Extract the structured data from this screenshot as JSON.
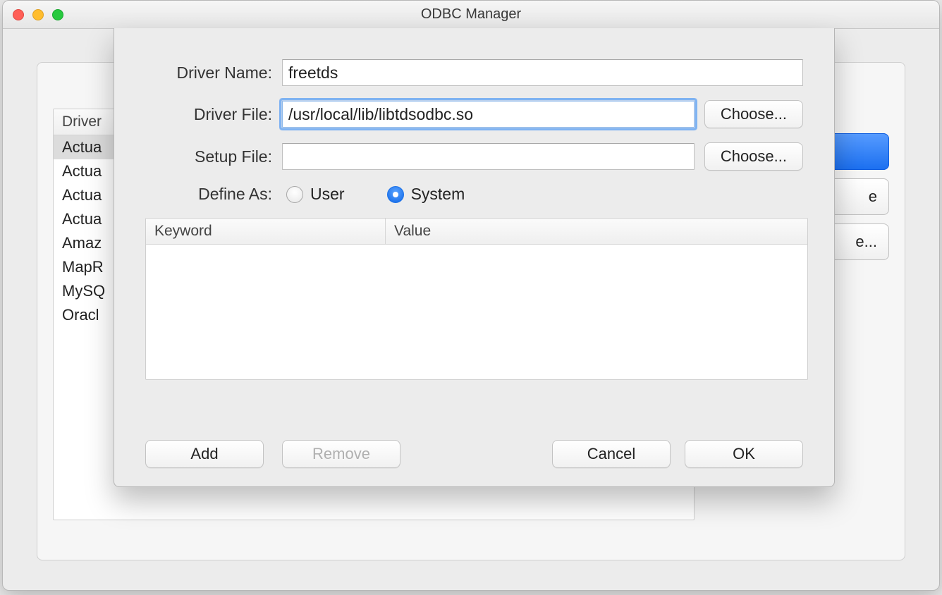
{
  "window": {
    "title": "ODBC Manager"
  },
  "background_list": {
    "header": "Driver",
    "rows": [
      "Actua",
      "Actua",
      "Actua",
      "Actua",
      "Amaz",
      "MapR",
      "MySQ",
      "Oracl"
    ],
    "selected_index": 0
  },
  "side_buttons": {
    "b1": "",
    "b2": "e",
    "b3": "e..."
  },
  "sheet": {
    "labels": {
      "driver_name": "Driver Name:",
      "driver_file": "Driver File:",
      "setup_file": "Setup File:",
      "define_as": "Define As:"
    },
    "values": {
      "driver_name": "freetds",
      "driver_file": "/usr/local/lib/libtdsodbc.so",
      "setup_file": ""
    },
    "choose_label": "Choose...",
    "define_as": {
      "user_label": "User",
      "system_label": "System",
      "selected": "system"
    },
    "kv_table": {
      "keyword_header": "Keyword",
      "value_header": "Value",
      "rows": []
    },
    "buttons": {
      "add": "Add",
      "remove": "Remove",
      "cancel": "Cancel",
      "ok": "OK"
    }
  }
}
